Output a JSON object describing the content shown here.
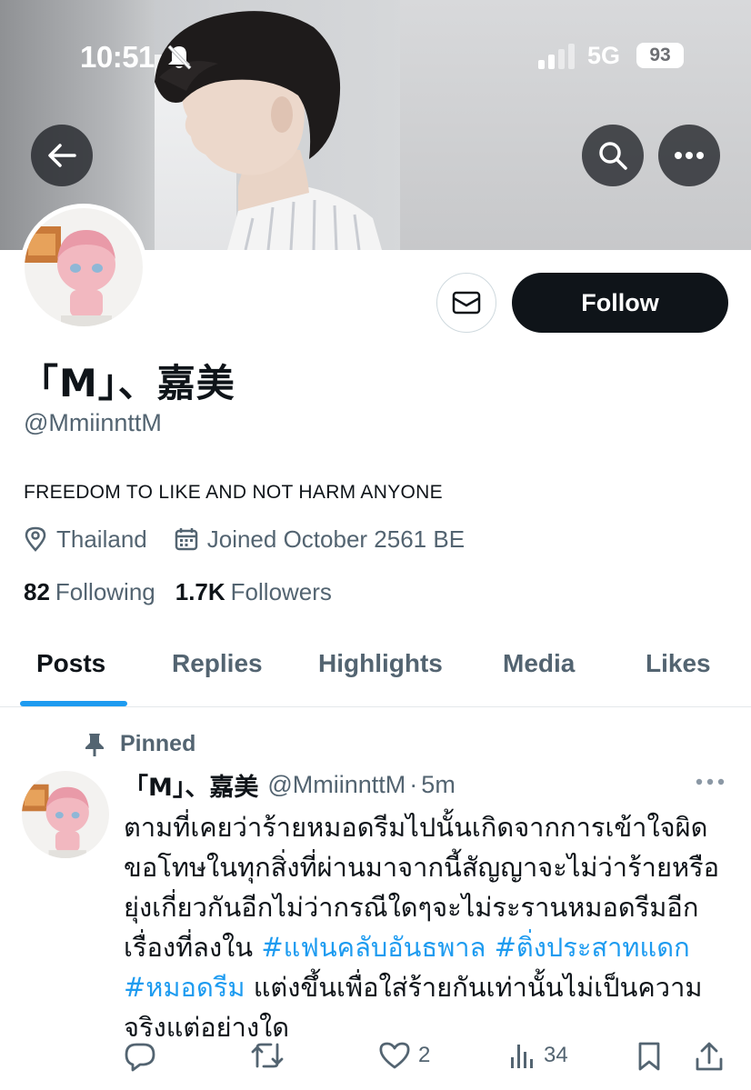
{
  "status_bar": {
    "time": "10:51",
    "network": "5G",
    "battery": "93"
  },
  "profile": {
    "display_name": "「M」、嘉美",
    "handle": "@MmiinnttM",
    "bio": "FREEDOM TO LIKE AND NOT HARM ANYONE",
    "location": "Thailand",
    "joined": "Joined October 2561 BE",
    "following_count": "82",
    "following_label": "Following",
    "followers_count": "1.7K",
    "followers_label": "Followers",
    "follow_label": "Follow"
  },
  "tabs": [
    {
      "label": "Posts",
      "active": true
    },
    {
      "label": "Replies",
      "active": false
    },
    {
      "label": "Highlights",
      "active": false
    },
    {
      "label": "Media",
      "active": false
    },
    {
      "label": "Likes",
      "active": false
    }
  ],
  "post": {
    "pinned_label": "Pinned",
    "name": "「M」、嘉美",
    "handle": "@MmiinnttM",
    "separator": "·",
    "time": "5m",
    "text_1": "ตามที่เคยว่าร้ายหมอดรีมไปนั้นเกิดจากการเข้าใจผิด ขอโทษในทุกสิ่งที่ผ่านมาจากนี้สัญญาจะไม่ว่าร้ายหรือยุ่งเกี่ยวกันอีกไม่ว่ากรณีใดๆจะไม่ระรานหมอดรีมอีก เรื่องที่ลงใน ",
    "hashtag_1": "#แฟนคลับอันธพาล",
    "space_1": " ",
    "hashtag_2": "#ติ่งประสาทแดก",
    "space_2": " ",
    "hashtag_3": "#หมอดรีม",
    "text_2": " แต่งขึ้นเพื่อใส่ร้ายกันเท่านั้นไม่เป็นความจริงแต่อย่างใด",
    "likes": "2",
    "views": "34"
  },
  "colors": {
    "accent": "#1d9bf0",
    "text_primary": "#0f1419",
    "text_secondary": "#536471",
    "follow_bg": "#0f1419"
  },
  "icons": {
    "back": "arrow-left-icon",
    "search": "search-icon",
    "more": "more-horizontal-icon",
    "message": "envelope-icon",
    "location": "location-pin-icon",
    "calendar": "calendar-icon",
    "pin": "pin-icon",
    "reply": "reply-icon",
    "retweet": "retweet-icon",
    "like": "heart-icon",
    "views": "views-bars-icon",
    "bookmark": "bookmark-icon",
    "share": "share-icon"
  }
}
